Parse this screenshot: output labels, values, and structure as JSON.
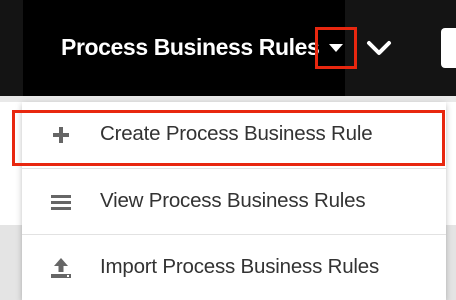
{
  "nav": {
    "title": "Process Business Rules",
    "caret_icon": "caret-down-icon",
    "chevron_icon": "chevron-down-icon"
  },
  "menu": {
    "items": [
      {
        "label": "Create Process Business Rule",
        "icon": "plus-icon"
      },
      {
        "label": "View Process Business Rules",
        "icon": "list-icon"
      },
      {
        "label": "Import Process Business Rules",
        "icon": "upload-icon"
      }
    ]
  },
  "colors": {
    "nav_background": "#141414",
    "highlight": "#e8270f",
    "menu_text": "#333333",
    "icon": "#666666"
  }
}
